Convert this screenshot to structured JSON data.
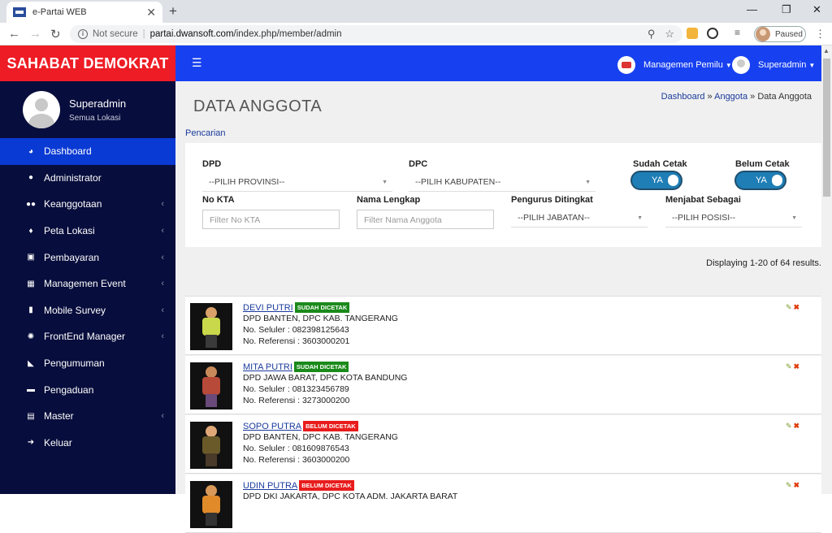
{
  "browser": {
    "tab_title": "e-Partai WEB",
    "not_secure": "Not secure",
    "url_host": "partai.dwansoft.com",
    "url_path": "/index.php/member/admin",
    "paused": "Paused"
  },
  "sidebar": {
    "brand": "SAHABAT DEMOKRAT",
    "user_name": "Superadmin",
    "user_location": "Semua Lokasi",
    "items": [
      {
        "label": "Dashboard",
        "icon": "dashboard-icon",
        "glyph": "◕",
        "chevron": false
      },
      {
        "label": "Administrator",
        "icon": "user-icon",
        "glyph": "●",
        "chevron": false
      },
      {
        "label": "Keanggotaan",
        "icon": "users-icon",
        "glyph": "●●",
        "chevron": true
      },
      {
        "label": "Peta Lokasi",
        "icon": "map-marker-icon",
        "glyph": "♦",
        "chevron": true
      },
      {
        "label": "Pembayaran",
        "icon": "money-icon",
        "glyph": "▣",
        "chevron": true
      },
      {
        "label": "Managemen Event",
        "icon": "calendar-icon",
        "glyph": "▦",
        "chevron": true
      },
      {
        "label": "Mobile Survey",
        "icon": "mobile-icon",
        "glyph": "▮",
        "chevron": true
      },
      {
        "label": "FrontEnd Manager",
        "icon": "gear-icon",
        "glyph": "✺",
        "chevron": true
      },
      {
        "label": "Pengumuman",
        "icon": "bullhorn-icon",
        "glyph": "◣",
        "chevron": false
      },
      {
        "label": "Pengaduan",
        "icon": "message-icon",
        "glyph": "▬",
        "chevron": false
      },
      {
        "label": "Master",
        "icon": "database-icon",
        "glyph": "▤",
        "chevron": true
      },
      {
        "label": "Keluar",
        "icon": "sign-out-icon",
        "glyph": "➜",
        "chevron": false
      }
    ]
  },
  "topnav": {
    "menu_icon": "hamburger-icon",
    "managemen_pemilu": "Managemen Pemilu",
    "user": "Superadmin"
  },
  "main": {
    "title": "DATA ANGGOTA",
    "breadcrumb": {
      "dashboard": "Dashboard",
      "anggota": "Anggota",
      "current": "Data Anggota"
    },
    "search_label": "Pencarian",
    "filters": {
      "dpd_label": "DPD",
      "dpd_value": "--PILIH PROVINSI--",
      "dpc_label": "DPC",
      "dpc_value": "--PILIH KABUPATEN--",
      "sudah_cetak_label": "Sudah Cetak",
      "sudah_cetak_value": "YA",
      "belum_cetak_label": "Belum Cetak",
      "belum_cetak_value": "YA",
      "no_kta_label": "No KTA",
      "no_kta_placeholder": "Filter No KTA",
      "nama_label": "Nama Lengkap",
      "nama_placeholder": "Filter Nama Anggota",
      "pengurus_label": "Pengurus Ditingkat",
      "pengurus_value": "--PILIH JABATAN--",
      "menjabat_label": "Menjabat Sebagai",
      "menjabat_value": "--PILIH POSISI--"
    },
    "results": "Displaying 1-20 of 64 results.",
    "members": [
      {
        "name": "DEVI PUTRI",
        "badge": "SUDAH DICETAK",
        "badge_color": "#1a8a1a",
        "region": "DPD BANTEN, DPC KAB. TANGERANG",
        "phone": "No. Seluler : 082398125643",
        "ref": "No. Referensi : 3603000201",
        "skin": "#d9a06a",
        "shirt": "#c8d84a",
        "legs": "#3a3a3a"
      },
      {
        "name": "MITA PUTRI",
        "badge": "SUDAH DICETAK",
        "badge_color": "#1a8a1a",
        "region": "DPD JAWA BARAT, DPC KOTA BANDUNG",
        "phone": "No. Seluler : 081323456789",
        "ref": "No. Referensi : 3273000200",
        "skin": "#c98a5a",
        "shirt": "#b84a3a",
        "legs": "#6a4a7a"
      },
      {
        "name": "SOPO PUTRA",
        "badge": "BELUM DICETAK",
        "badge_color": "#e81c1c",
        "region": "DPD BANTEN, DPC KAB. TANGERANG",
        "phone": "No. Seluler : 081609876543",
        "ref": "No. Referensi : 3603000200",
        "skin": "#e0a878",
        "shirt": "#6a5a2a",
        "legs": "#4a3a2a"
      },
      {
        "name": "UDIN PUTRA",
        "badge": "BELUM DICETAK",
        "badge_color": "#e81c1c",
        "region": "DPD DKI JAKARTA, DPC KOTA ADM. JAKARTA BARAT",
        "phone": "",
        "ref": "",
        "skin": "#d8985a",
        "shirt": "#e08a2a",
        "legs": "#333"
      }
    ]
  }
}
